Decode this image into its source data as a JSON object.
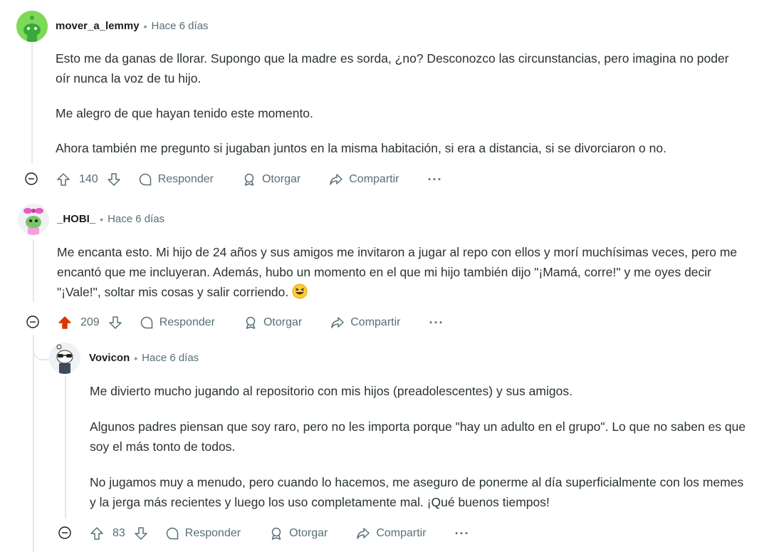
{
  "comments": [
    {
      "username": "mover_a_lemmy",
      "separator": "•",
      "time": "Hace 6 días",
      "paragraphs": [
        "Esto me da ganas de llorar. Supongo que la madre es sorda, ¿no? Desconozco las circunstancias, pero imagina no poder oír nunca la voz de tu hijo.",
        "Me alegro de que hayan tenido este momento.",
        "Ahora también me pregunto si jugaban juntos en la misma habitación, si era a distancia, si se divorciaron o no."
      ],
      "votes": "140",
      "upvoted": false,
      "reply_label": "Responder",
      "award_label": "Otorgar",
      "share_label": "Compartir",
      "more_label": "···",
      "avatar_icon": "green-snoo-avatar-icon"
    },
    {
      "username": "_HOBI_",
      "separator": "•",
      "time": "Hace 6 días",
      "paragraphs": [
        "Me encanta esto. Mi hijo de 24 años y sus amigos me invitaron a jugar al repo con ellos y morí muchísimas veces, pero me encantó que me incluyeran. Además, hubo un momento en el que mi hijo también dijo \"¡Mamá, corre!\" y me oyes decir \"¡Vale!\", soltar mis cosas y salir corriendo."
      ],
      "emoji": "grinning-squinting-face-emoji",
      "votes": "209",
      "upvoted": true,
      "reply_label": "Responder",
      "award_label": "Otorgar",
      "share_label": "Compartir",
      "more_label": "···",
      "avatar_icon": "pink-bow-snoo-avatar-icon"
    },
    {
      "username": "Vovicon",
      "separator": "•",
      "time": "Hace 6 días",
      "paragraphs": [
        "Me divierto mucho jugando al repositorio con mis hijos (preadolescentes) y sus amigos.",
        "Algunos padres piensan que soy raro, pero no les importa porque \"hay un adulto en el grupo\". Lo que no saben es que soy el más tonto de todos.",
        "No jugamos muy a menudo, pero cuando lo hacemos, me aseguro de ponerme al día superficialmente con los memes y la jerga más recientes y luego los uso completamente mal. ¡Qué buenos tiempos!"
      ],
      "votes": "83",
      "upvoted": false,
      "reply_label": "Responder",
      "award_label": "Otorgar",
      "share_label": "Compartir",
      "more_label": "···",
      "avatar_icon": "sunglasses-snoo-avatar-icon"
    }
  ],
  "colors": {
    "upvote_active": "#d93900",
    "meta_text": "#576f76",
    "body_text": "#2a3236",
    "thread_line": "#e5e8ea"
  }
}
